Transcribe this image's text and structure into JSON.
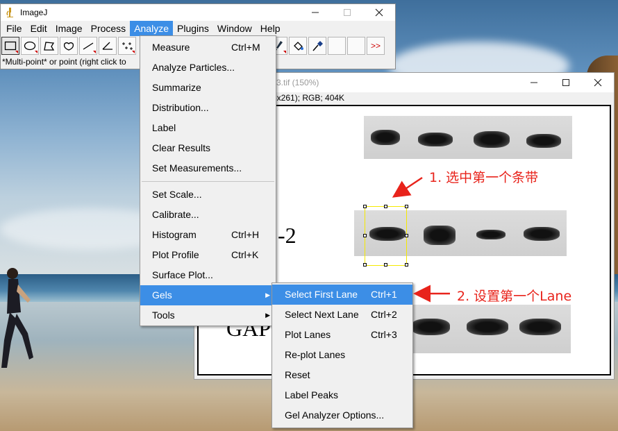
{
  "main_window": {
    "title": "ImageJ",
    "menus": [
      "File",
      "Edit",
      "Image",
      "Process",
      "Analyze",
      "Plugins",
      "Window",
      "Help"
    ],
    "active_menu": "Analyze",
    "status": "*Multi-point* or point (right click to",
    "more_tools": ">>"
  },
  "image_window": {
    "title": "3.tif (150%)",
    "info": "6x261); RGB; 404K",
    "labels": {
      "row2": "-2",
      "row3": "GAPI"
    }
  },
  "analyze_menu": {
    "items": [
      {
        "label": "Measure",
        "shortcut": "Ctrl+M"
      },
      {
        "label": "Analyze Particles...",
        "shortcut": ""
      },
      {
        "label": "Summarize",
        "shortcut": ""
      },
      {
        "label": "Distribution...",
        "shortcut": ""
      },
      {
        "label": "Label",
        "shortcut": ""
      },
      {
        "label": "Clear Results",
        "shortcut": ""
      },
      {
        "label": "Set Measurements...",
        "shortcut": ""
      },
      {
        "label": "Set Scale...",
        "shortcut": ""
      },
      {
        "label": "Calibrate...",
        "shortcut": ""
      },
      {
        "label": "Histogram",
        "shortcut": "Ctrl+H"
      },
      {
        "label": "Plot Profile",
        "shortcut": "Ctrl+K"
      },
      {
        "label": "Surface Plot...",
        "shortcut": ""
      },
      {
        "label": "Gels",
        "shortcut": ""
      },
      {
        "label": "Tools",
        "shortcut": ""
      }
    ]
  },
  "gels_menu": {
    "items": [
      {
        "label": "Select First Lane",
        "shortcut": "Ctrl+1"
      },
      {
        "label": "Select Next Lane",
        "shortcut": "Ctrl+2"
      },
      {
        "label": "Plot Lanes",
        "shortcut": "Ctrl+3"
      },
      {
        "label": "Re-plot Lanes",
        "shortcut": ""
      },
      {
        "label": "Reset",
        "shortcut": ""
      },
      {
        "label": "Label Peaks",
        "shortcut": ""
      },
      {
        "label": "Gel Analyzer Options...",
        "shortcut": ""
      }
    ]
  },
  "annotations": {
    "step1": "1. 选中第一个条带",
    "step2": "2. 设置第一个Lane"
  },
  "colors": {
    "highlight": "#3c8ee6",
    "annotation": "#e8231b",
    "selection": "#f5e900"
  }
}
